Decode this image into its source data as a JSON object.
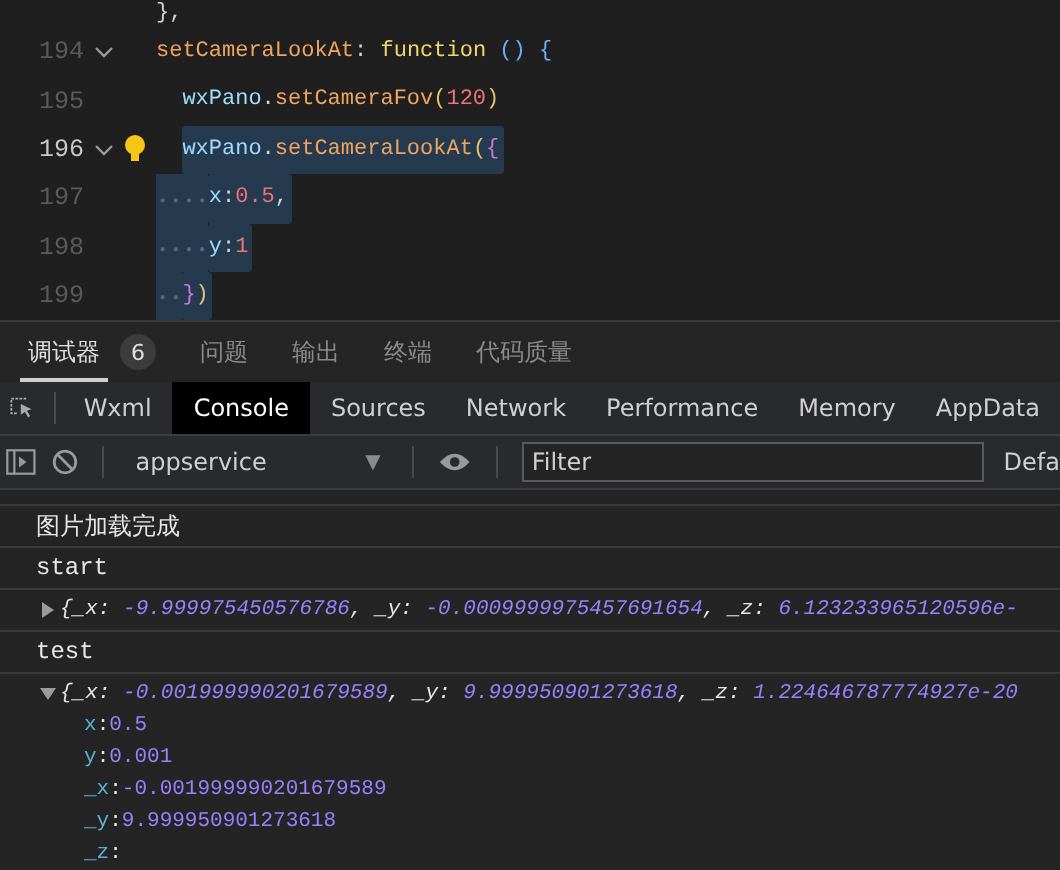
{
  "editor": {
    "lines": [
      {
        "selected": false,
        "tokens": [
          {
            "kind": "punct",
            "text": "},"
          }
        ]
      },
      {
        "number": "194",
        "fold": true,
        "selected": false,
        "tokens": [
          {
            "kind": "prop",
            "text": "setCameraLookAt"
          },
          {
            "kind": "punct",
            "text": ":"
          },
          {
            "kind": "keyword",
            "text": " function"
          },
          {
            "kind": "paren",
            "text": " ()"
          },
          {
            "kind": "paren",
            "text": " {"
          }
        ],
        "children": [
          {
            "number": "195",
            "selected": false,
            "tokens": [
              {
                "kind": "ident",
                "text": "wxPano"
              },
              {
                "kind": "punct",
                "text": "."
              },
              {
                "kind": "fn",
                "text": "setCameraFov"
              },
              {
                "kind": "paren2",
                "text": "("
              },
              {
                "kind": "number",
                "text": "120"
              },
              {
                "kind": "paren2",
                "text": ")"
              }
            ]
          },
          {
            "number": "196",
            "fold": true,
            "bulb": true,
            "current": true,
            "selected": true,
            "tokens": [
              {
                "kind": "ident",
                "text": "wxPano"
              },
              {
                "kind": "punct",
                "text": "."
              },
              {
                "kind": "fn",
                "text": "setCameraLookAt"
              },
              {
                "kind": "paren2",
                "text": "("
              },
              {
                "kind": "paren3",
                "text": "{"
              }
            ],
            "children": [
              {
                "number": "197",
                "selected": true,
                "tokens": [
                  {
                    "kind": "ident",
                    "text": "x"
                  },
                  {
                    "kind": "punct",
                    "text": ":"
                  },
                  {
                    "kind": "number",
                    "text": "0.5"
                  },
                  {
                    "kind": "punct",
                    "text": ","
                  }
                ]
              },
              {
                "number": "198",
                "selected": true,
                "tokens": [
                  {
                    "kind": "ident",
                    "text": "y"
                  },
                  {
                    "kind": "punct",
                    "text": ":"
                  },
                  {
                    "kind": "number",
                    "text": "1"
                  }
                ]
              }
            ]
          },
          {
            "number": "199",
            "selected": true,
            "tokens": [
              {
                "kind": "paren3",
                "text": "}"
              },
              {
                "kind": "paren2",
                "text": ")"
              }
            ]
          }
        ]
      }
    ]
  },
  "panel_tabs": [
    {
      "label": "调试器",
      "selected": true,
      "badge": "6"
    },
    {
      "label": "问题",
      "selected": false
    },
    {
      "label": "输出",
      "selected": false
    },
    {
      "label": "终端",
      "selected": false
    },
    {
      "label": "代码质量",
      "selected": false
    }
  ],
  "devtools_tabs": [
    {
      "label": "Wxml",
      "selected": false
    },
    {
      "label": "Console",
      "selected": true
    },
    {
      "label": "Sources",
      "selected": false
    },
    {
      "label": "Network",
      "selected": false
    },
    {
      "label": "Performance",
      "selected": false
    },
    {
      "label": "Memory",
      "selected": false
    },
    {
      "label": "AppData",
      "selected": false
    }
  ],
  "toolbar": {
    "context": "appservice",
    "context_caret": "▼",
    "filter": {
      "placeholder": "Filter"
    },
    "levels": "Defa"
  },
  "console": [
    {
      "kind": "text",
      "text": "图片加载完成"
    },
    {
      "kind": "text",
      "text": "start"
    },
    {
      "kind": "object",
      "expanded": false,
      "preview": [
        {
          "kind": "key",
          "text": "{_x: "
        },
        {
          "kind": "value",
          "text": "-9.999975450576786"
        },
        {
          "kind": "key",
          "text": ", _y: "
        },
        {
          "kind": "value",
          "text": "-0.0009999975457691654"
        },
        {
          "kind": "key",
          "text": ", _z: "
        },
        {
          "kind": "value",
          "text": "6.123233965120596e-"
        }
      ]
    },
    {
      "kind": "text",
      "text": "test"
    },
    {
      "kind": "object",
      "expanded": true,
      "preview": [
        {
          "kind": "key",
          "text": "{_x: "
        },
        {
          "kind": "value",
          "text": "-0.001999990201679589"
        },
        {
          "kind": "key",
          "text": ", _y: "
        },
        {
          "kind": "value",
          "text": "9.999950901273618"
        },
        {
          "kind": "key",
          "text": ", _z: "
        },
        {
          "kind": "value",
          "text": "1.224646787774927e-20"
        }
      ],
      "properties": [
        {
          "key": "x",
          "colon": ":",
          "value": "0.5"
        },
        {
          "key": "y",
          "colon": ":",
          "value": "0.001"
        },
        {
          "key": "_x",
          "colon": ":",
          "value": "-0.001999990201679589"
        },
        {
          "key": "_y",
          "colon": ":",
          "value": "9.999950901273618"
        },
        {
          "key": "_z",
          "colon": ":"
        }
      ]
    }
  ]
}
